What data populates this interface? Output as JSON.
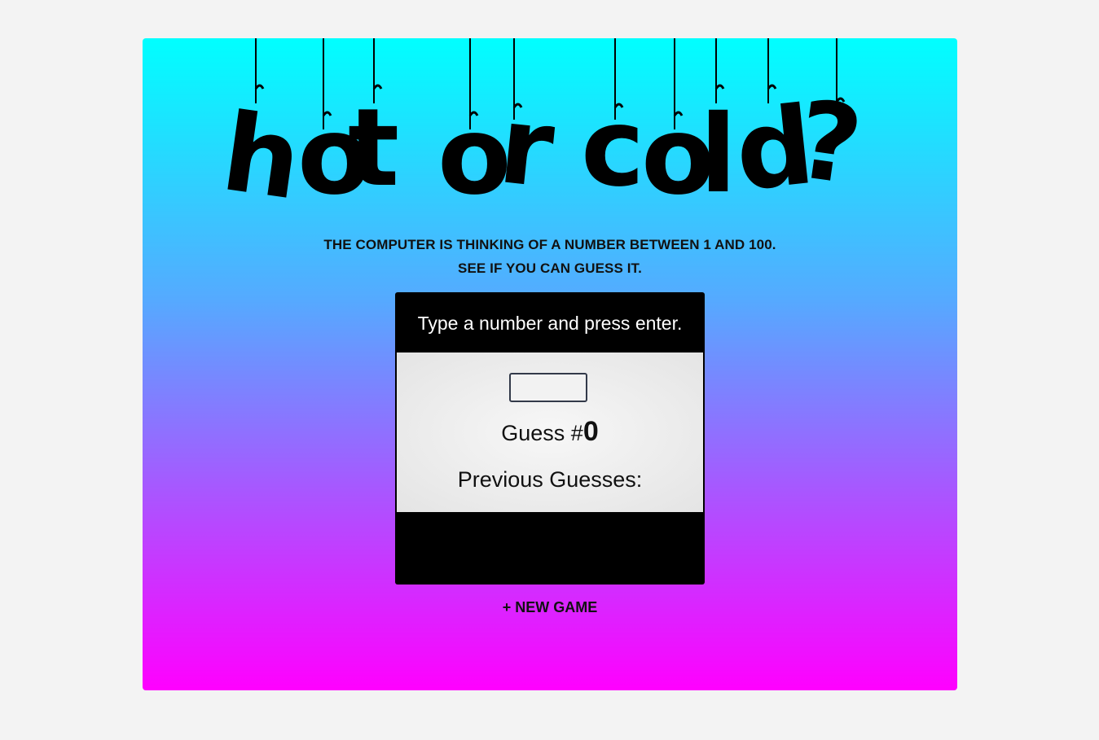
{
  "logo": {
    "text": "hot or cold?",
    "letters": [
      "h",
      "o",
      "t",
      "o",
      "r",
      "c",
      "o",
      "l",
      "d",
      "?"
    ]
  },
  "intro": {
    "line1": "THE COMPUTER IS THINKING OF A NUMBER BETWEEN 1 AND 100.",
    "line2": "SEE IF YOU CAN GUESS IT."
  },
  "game": {
    "prompt": "Type a number and press enter.",
    "input_value": "",
    "guess_label": "Guess #",
    "guess_count": "0",
    "previous_label": "Previous Guesses:",
    "previous_guesses": []
  },
  "new_game": {
    "label": "+ NEW GAME"
  },
  "colors": {
    "gradient_top": "#00ffff",
    "gradient_bottom": "#ff00ff",
    "page_background": "#f3f3f3",
    "panel_dark": "#000000",
    "panel_light": "#e6e6e6"
  }
}
